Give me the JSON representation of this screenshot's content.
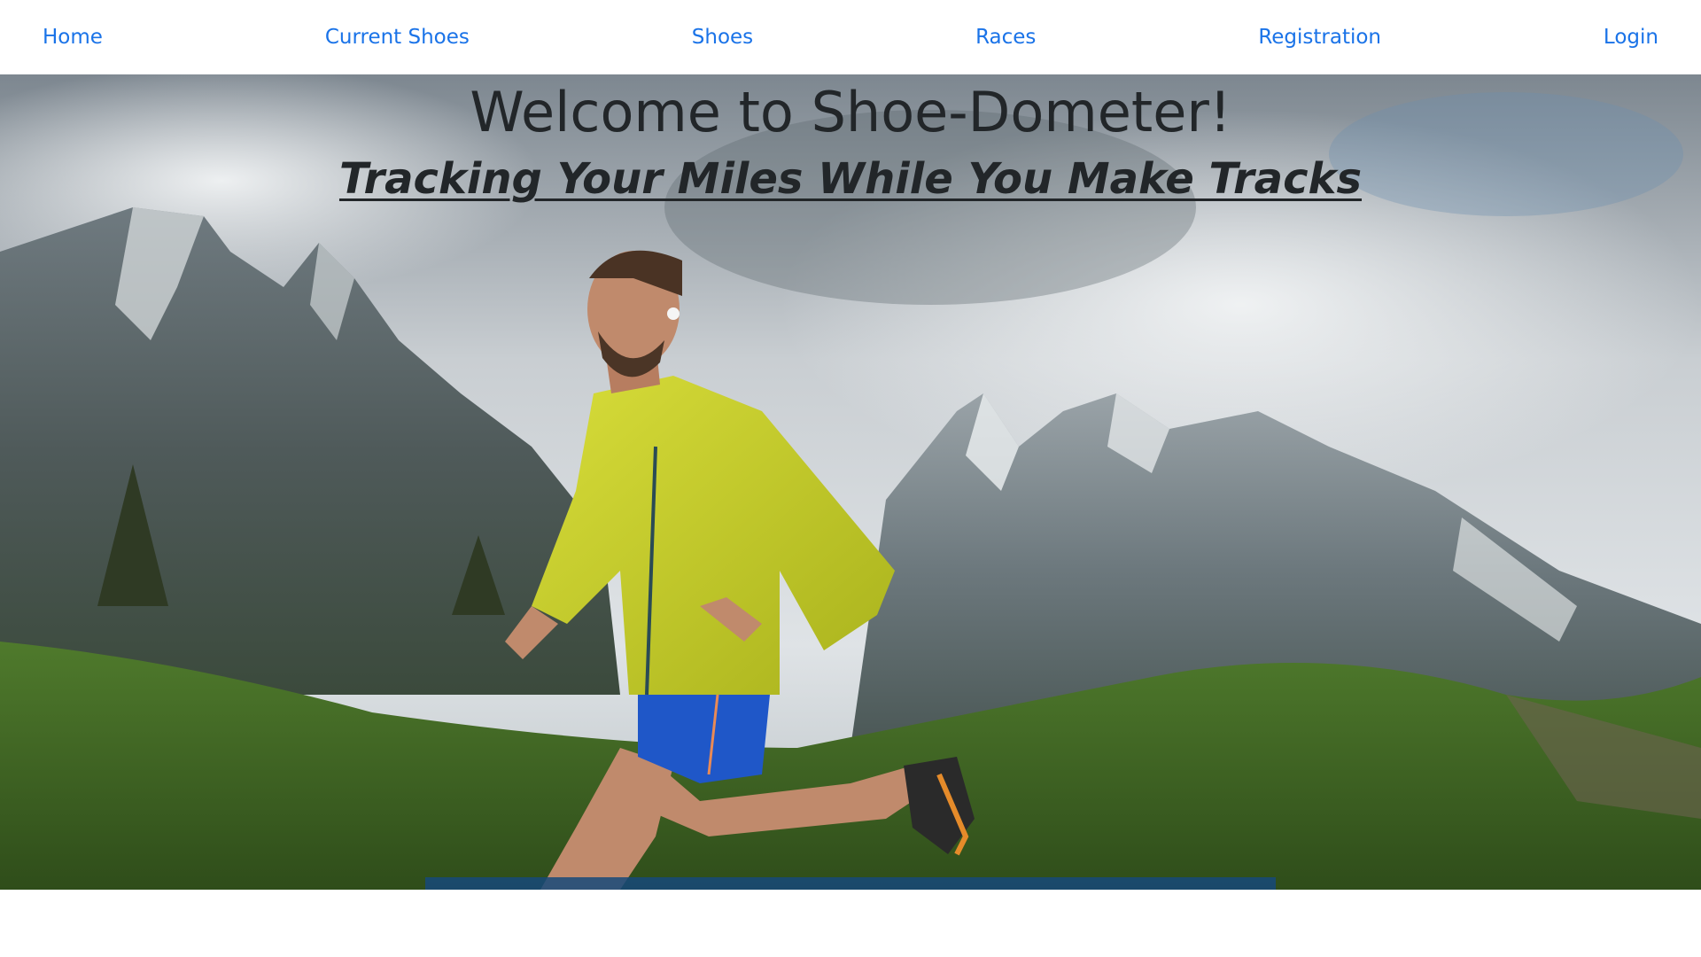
{
  "nav": {
    "items": [
      {
        "label": "Home"
      },
      {
        "label": "Current Shoes"
      },
      {
        "label": "Shoes"
      },
      {
        "label": "Races"
      },
      {
        "label": "Registration"
      },
      {
        "label": "Login"
      }
    ]
  },
  "hero": {
    "title": "Welcome to Shoe-Dometer!",
    "subtitle": "Tracking Your Miles While You Make Tracks"
  },
  "colors": {
    "link": "#1a73e8",
    "heading": "#222629",
    "jacket": "#c9d22a",
    "shorts": "#1f57c8",
    "grass": "#3f6a24"
  }
}
